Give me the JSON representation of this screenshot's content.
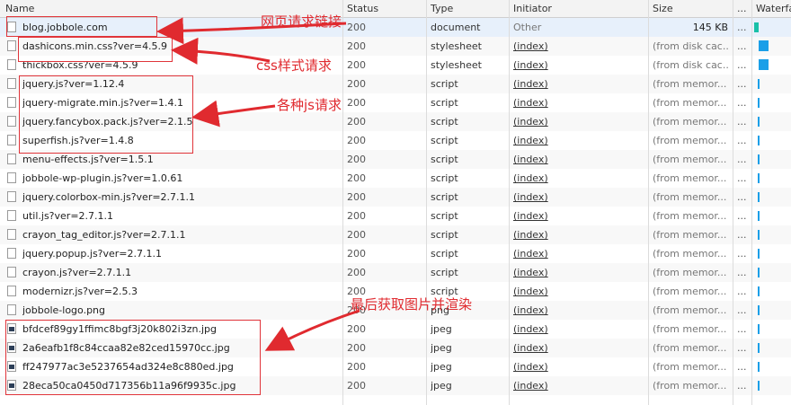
{
  "columns": {
    "name": "Name",
    "status": "Status",
    "type": "Type",
    "initiator": "Initiator",
    "size": "Size",
    "dots": "...",
    "waterfall": "Waterfa"
  },
  "rows": [
    {
      "name": "blog.jobbole.com",
      "status": "200",
      "type": "document",
      "initiator": "Other",
      "size": "145 KB",
      "dots": "...",
      "icon": "file-icon"
    },
    {
      "name": "dashicons.min.css?ver=4.5.9",
      "status": "200",
      "type": "stylesheet",
      "initiator": "(index)",
      "size": "(from disk cac...",
      "dots": "...",
      "icon": "file-icon"
    },
    {
      "name": "thickbox.css?ver=4.5.9",
      "status": "200",
      "type": "stylesheet",
      "initiator": "(index)",
      "size": "(from disk cac...",
      "dots": "...",
      "icon": "file-icon"
    },
    {
      "name": "jquery.js?ver=1.12.4",
      "status": "200",
      "type": "script",
      "initiator": "(index)",
      "size": "(from memor...",
      "dots": "...",
      "icon": "file-icon"
    },
    {
      "name": "jquery-migrate.min.js?ver=1.4.1",
      "status": "200",
      "type": "script",
      "initiator": "(index)",
      "size": "(from memor...",
      "dots": "...",
      "icon": "file-icon"
    },
    {
      "name": "jquery.fancybox.pack.js?ver=2.1.5",
      "status": "200",
      "type": "script",
      "initiator": "(index)",
      "size": "(from memor...",
      "dots": "...",
      "icon": "file-icon"
    },
    {
      "name": "superfish.js?ver=1.4.8",
      "status": "200",
      "type": "script",
      "initiator": "(index)",
      "size": "(from memor...",
      "dots": "...",
      "icon": "file-icon"
    },
    {
      "name": "menu-effects.js?ver=1.5.1",
      "status": "200",
      "type": "script",
      "initiator": "(index)",
      "size": "(from memor...",
      "dots": "...",
      "icon": "file-icon"
    },
    {
      "name": "jobbole-wp-plugin.js?ver=1.0.61",
      "status": "200",
      "type": "script",
      "initiator": "(index)",
      "size": "(from memor...",
      "dots": "...",
      "icon": "file-icon"
    },
    {
      "name": "jquery.colorbox-min.js?ver=2.7.1.1",
      "status": "200",
      "type": "script",
      "initiator": "(index)",
      "size": "(from memor...",
      "dots": "...",
      "icon": "file-icon"
    },
    {
      "name": "util.js?ver=2.7.1.1",
      "status": "200",
      "type": "script",
      "initiator": "(index)",
      "size": "(from memor...",
      "dots": "...",
      "icon": "file-icon"
    },
    {
      "name": "crayon_tag_editor.js?ver=2.7.1.1",
      "status": "200",
      "type": "script",
      "initiator": "(index)",
      "size": "(from memor...",
      "dots": "...",
      "icon": "file-icon"
    },
    {
      "name": "jquery.popup.js?ver=2.7.1.1",
      "status": "200",
      "type": "script",
      "initiator": "(index)",
      "size": "(from memor...",
      "dots": "...",
      "icon": "file-icon"
    },
    {
      "name": "crayon.js?ver=2.7.1.1",
      "status": "200",
      "type": "script",
      "initiator": "(index)",
      "size": "(from memor...",
      "dots": "...",
      "icon": "file-icon"
    },
    {
      "name": "modernizr.js?ver=2.5.3",
      "status": "200",
      "type": "script",
      "initiator": "(index)",
      "size": "(from memor...",
      "dots": "...",
      "icon": "file-icon"
    },
    {
      "name": "jobbole-logo.png",
      "status": "200",
      "type": "png",
      "initiator": "(index)",
      "size": "(from memor...",
      "dots": "...",
      "icon": "file-icon"
    },
    {
      "name": "bfdcef89gy1ffimc8bgf3j20k802i3zn.jpg",
      "status": "200",
      "type": "jpeg",
      "initiator": "(index)",
      "size": "(from memor...",
      "dots": "...",
      "icon": "image-icon"
    },
    {
      "name": "2a6eafb1f8c84ccaa82e82ced15970cc.jpg",
      "status": "200",
      "type": "jpeg",
      "initiator": "(index)",
      "size": "(from memor...",
      "dots": "...",
      "icon": "image-icon"
    },
    {
      "name": "ff247977ac3e5237654ad324e8c880ed.jpg",
      "status": "200",
      "type": "jpeg",
      "initiator": "(index)",
      "size": "(from memor...",
      "dots": "...",
      "icon": "image-icon"
    },
    {
      "name": "28eca50ca0450d717356b11a96f9935c.jpg",
      "status": "200",
      "type": "jpeg",
      "initiator": "(index)",
      "size": "(from memor...",
      "dots": "...",
      "icon": "image-icon"
    }
  ],
  "annotations": {
    "page_request": "网页请求链接",
    "css_request": "css样式请求",
    "js_request": "各种js请求",
    "image_request": "最后获取图片并渲染"
  },
  "colors": {
    "annotation": "#e02a2f",
    "selected_row": "#e7f0fb",
    "waterfall_document": "#19c0a8",
    "waterfall_stylesheet": "#1a9fe8",
    "waterfall_script": "#1a9fe8"
  }
}
